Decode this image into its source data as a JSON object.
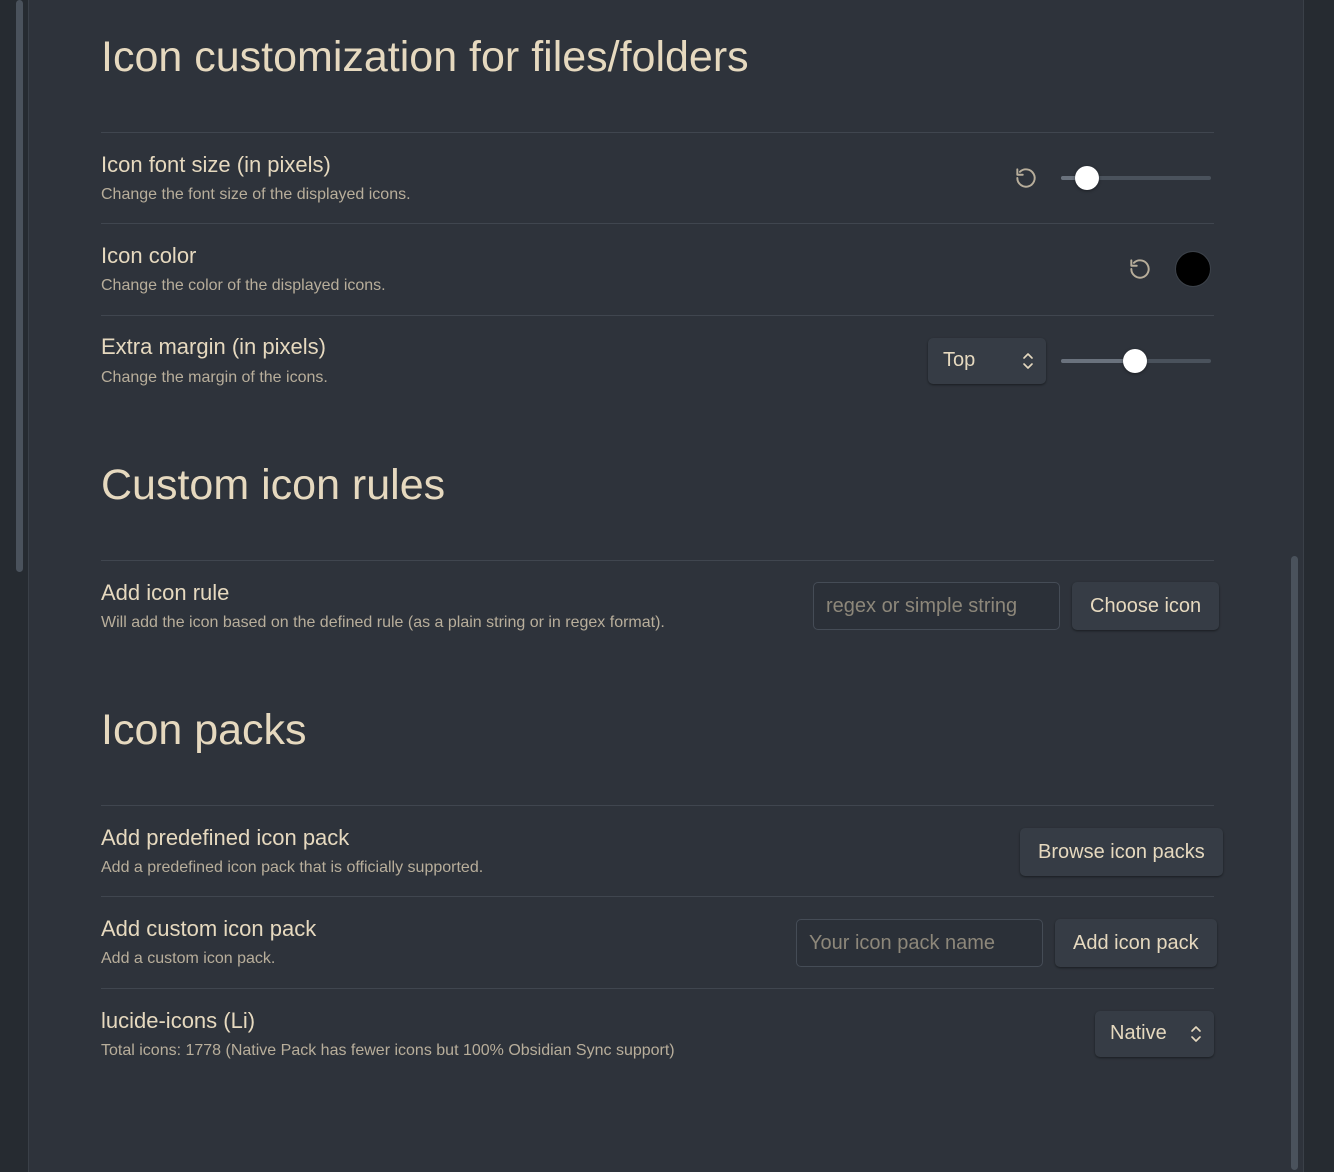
{
  "sections": {
    "customization": {
      "title": "Icon customization for files/folders",
      "font_size": {
        "name": "Icon font size (in pixels)",
        "desc": "Change the font size of the displayed icons.",
        "slider_fraction": 0.17
      },
      "color": {
        "name": "Icon color",
        "desc": "Change the color of the displayed icons.",
        "value": "#000000"
      },
      "margin": {
        "name": "Extra margin (in pixels)",
        "desc": "Change the margin of the icons.",
        "position_value": "Top",
        "slider_fraction": 0.49
      }
    },
    "rules": {
      "title": "Custom icon rules",
      "add_rule": {
        "name": "Add icon rule",
        "desc": "Will add the icon based on the defined rule (as a plain string or in regex format).",
        "placeholder": "regex or simple string",
        "button": "Choose icon"
      }
    },
    "packs": {
      "title": "Icon packs",
      "predefined": {
        "name": "Add predefined icon pack",
        "desc": "Add a predefined icon pack that is officially supported.",
        "button": "Browse icon packs"
      },
      "custom": {
        "name": "Add custom icon pack",
        "desc": "Add a custom icon pack.",
        "placeholder": "Your icon pack name",
        "button": "Add icon pack"
      },
      "lucide": {
        "name": "lucide-icons (Li)",
        "desc": "Total icons: 1778 (Native Pack has fewer icons but 100% Obsidian Sync support)",
        "mode_value": "Native"
      }
    }
  },
  "colors": {
    "background": "#2e333b",
    "text": "#e6d9bf",
    "muted": "#b8ae9b"
  },
  "icons": [
    "reset-icon",
    "chevron-up-down-icon"
  ]
}
